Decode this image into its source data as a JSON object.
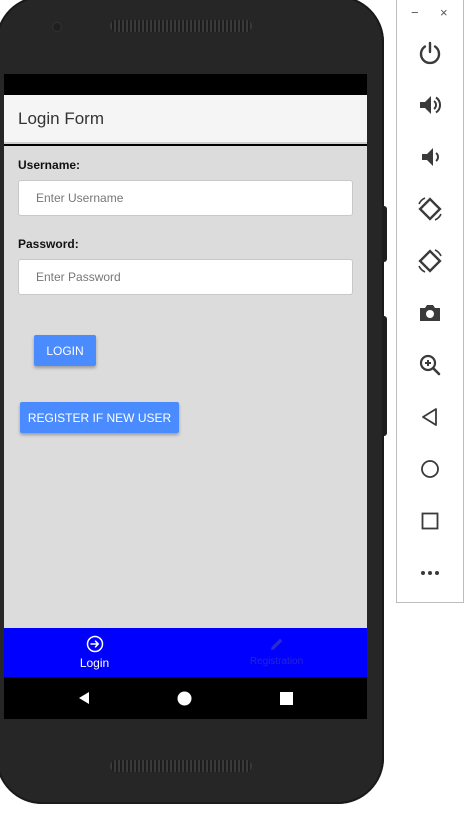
{
  "app": {
    "title": "Login Form"
  },
  "form": {
    "username_label": "Username:",
    "username_placeholder": "Enter Username",
    "username_value": "",
    "password_label": "Password:",
    "password_placeholder": "Enter Password",
    "password_value": "",
    "login_button": "LOGIN",
    "register_button": "REGISTER IF NEW USER"
  },
  "tabs": [
    {
      "label": "Login",
      "icon": "login-icon",
      "active": true
    },
    {
      "label": "Registration",
      "icon": "pencil-icon",
      "active": false
    }
  ],
  "emulator": {
    "minimize": "−",
    "close": "×",
    "tools": [
      "power-icon",
      "volume-up-icon",
      "volume-down-icon",
      "rotate-left-icon",
      "rotate-right-icon",
      "camera-icon",
      "zoom-in-icon",
      "back-icon",
      "home-icon",
      "overview-icon",
      "more-icon"
    ]
  },
  "colors": {
    "accent": "#4a8cff",
    "tabbar": "#0000ff",
    "content_bg": "#dcdcdc",
    "appbar_bg": "#f5f5f5",
    "emulator_icon": "#3a3a3a"
  }
}
